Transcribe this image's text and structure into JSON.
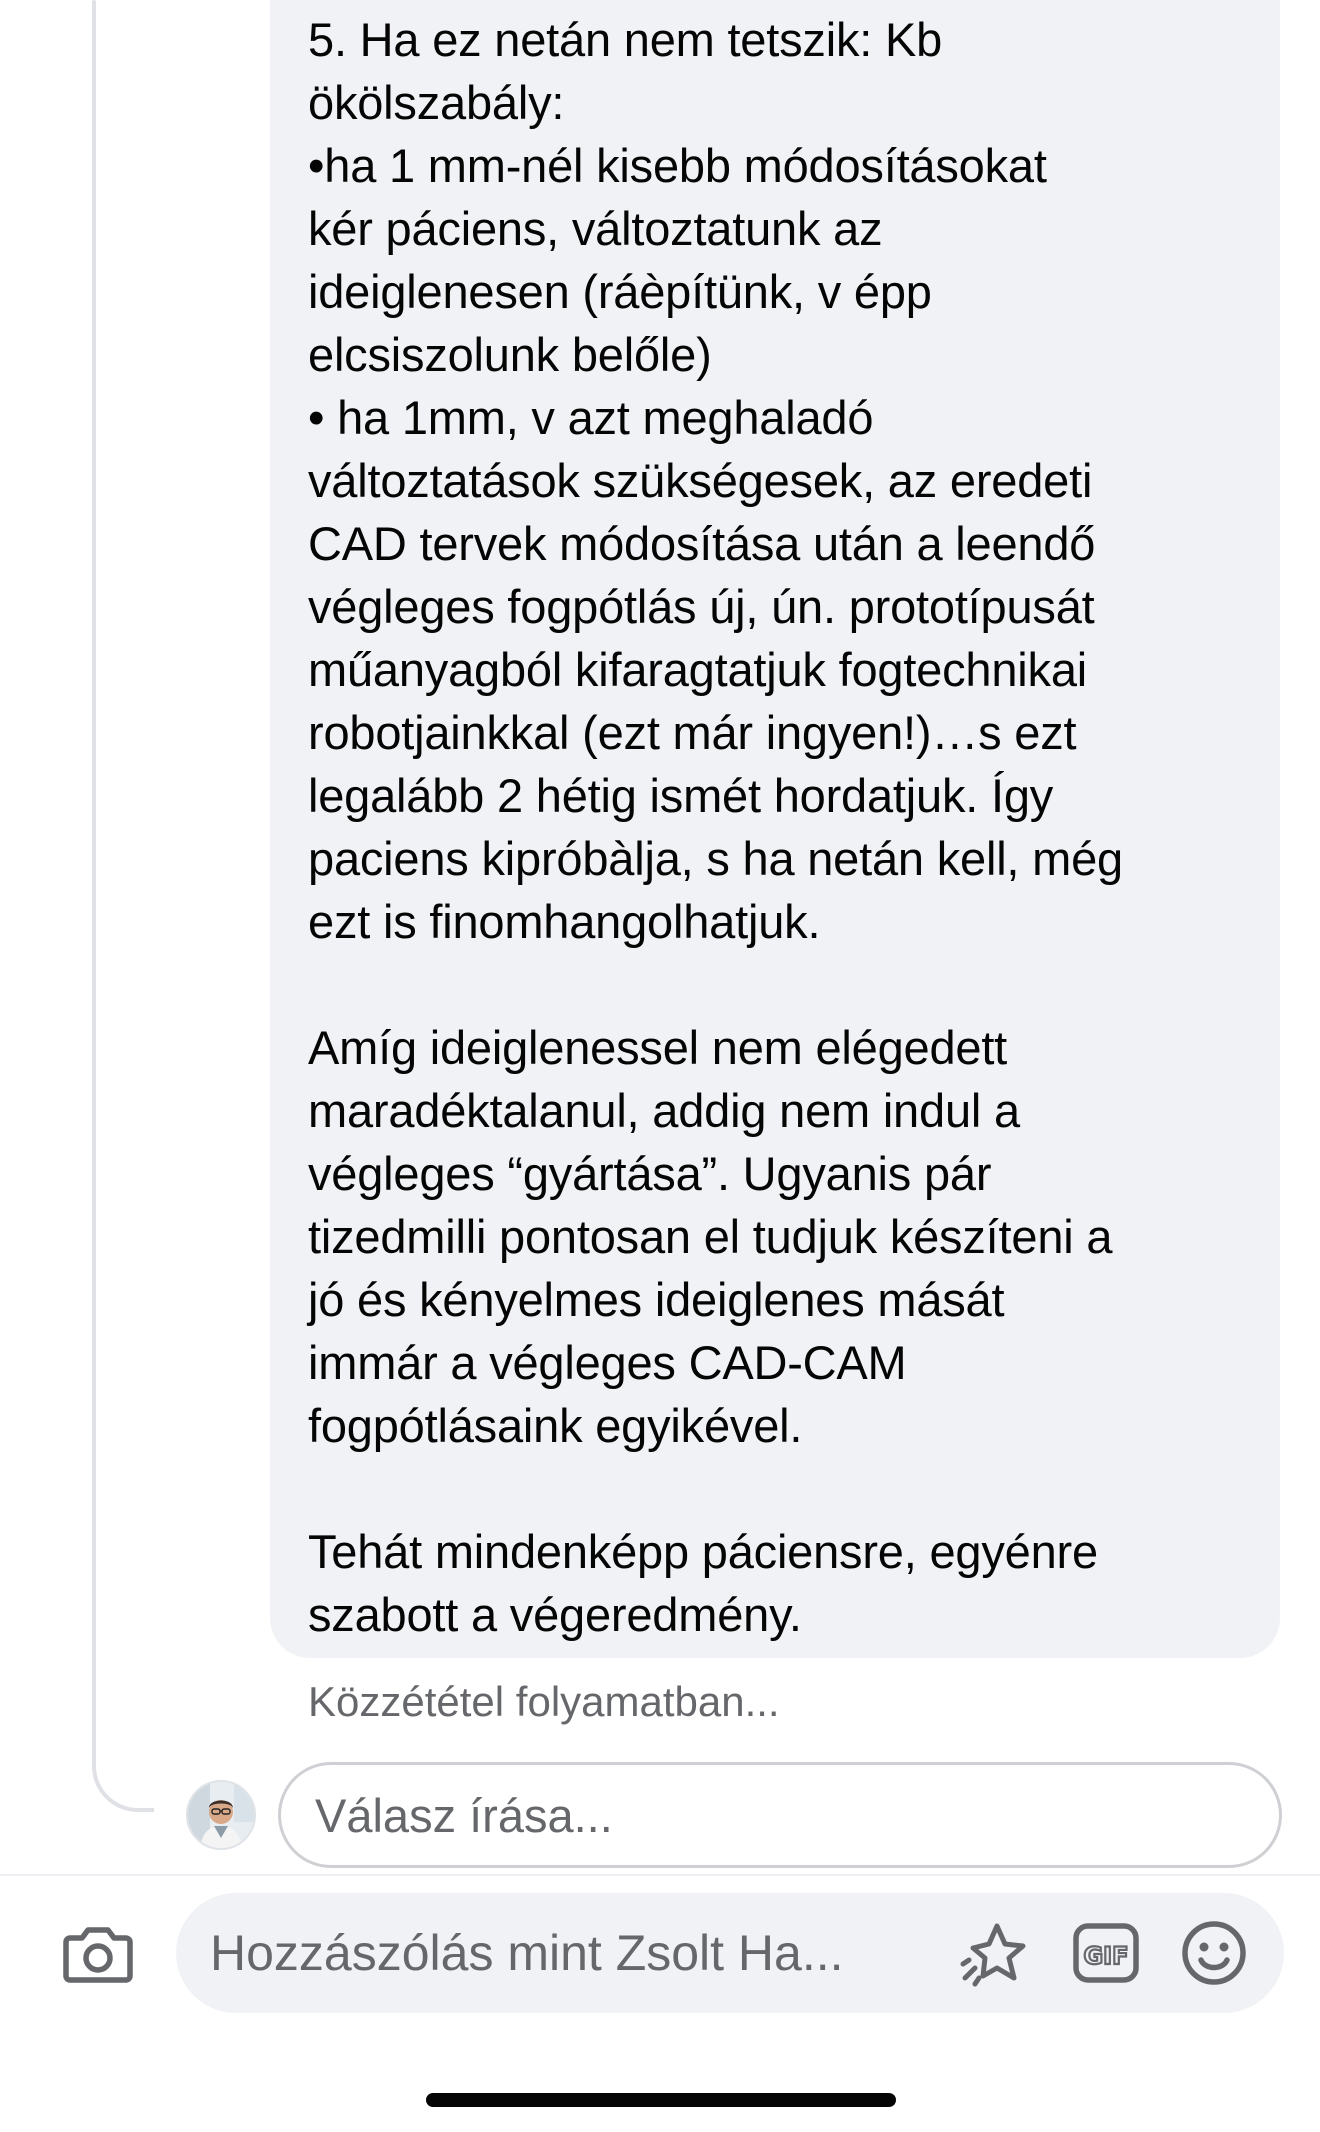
{
  "comment": {
    "lines": [
      "5. Ha ez netán nem tetszik: Kb",
      "ökölszabály:",
      "•ha 1 mm-nél kisebb módosításokat",
      "kér páciens, változtatunk az",
      "ideiglenesen (ráèpítünk, v épp",
      "elcsiszolunk belőle)",
      "• ha 1mm, v azt meghaladó",
      "változtatások szükségesek, az eredeti",
      "CAD tervek módosítása után a leendő",
      "végleges fogpótlás új, ún. prototípusát",
      "műanyagból kifaragtatjuk fogtechnikai",
      "robotjainkkal (ezt már ingyen!)…s ezt",
      "legalább 2 hétig ismét hordatjuk. Így",
      "paciens kipróbàlja, s ha netán kell, még",
      "ezt is finomhangolhatjuk.",
      "",
      "Amíg ideiglenessel nem elégedett",
      "maradéktalanul, addig nem indul a",
      "végleges “gyártása”. Ugyanis pár",
      "tizedmilli pontosan el tudjuk készíteni a",
      "jó és kényelmes ideiglenes mását",
      "immár a végleges CAD-CAM",
      "fogpótlásaink egyikével.",
      "",
      "Tehát mindenképp páciensre, egyénre",
      "szabott a végeredmény."
    ],
    "status": "Közzététel folyamatban..."
  },
  "reply": {
    "placeholder": "Válasz írása..."
  },
  "composer": {
    "placeholder": "Hozzászólás mint Zsolt Ha...",
    "icons": [
      "camera-icon",
      "sticker-icon",
      "gif-icon",
      "emoji-icon"
    ],
    "gif_label": "GIF"
  },
  "colors": {
    "bubble": "#f0f2f5",
    "text": "#050505",
    "secondary_text": "#65676b",
    "border": "#ced0d4"
  }
}
